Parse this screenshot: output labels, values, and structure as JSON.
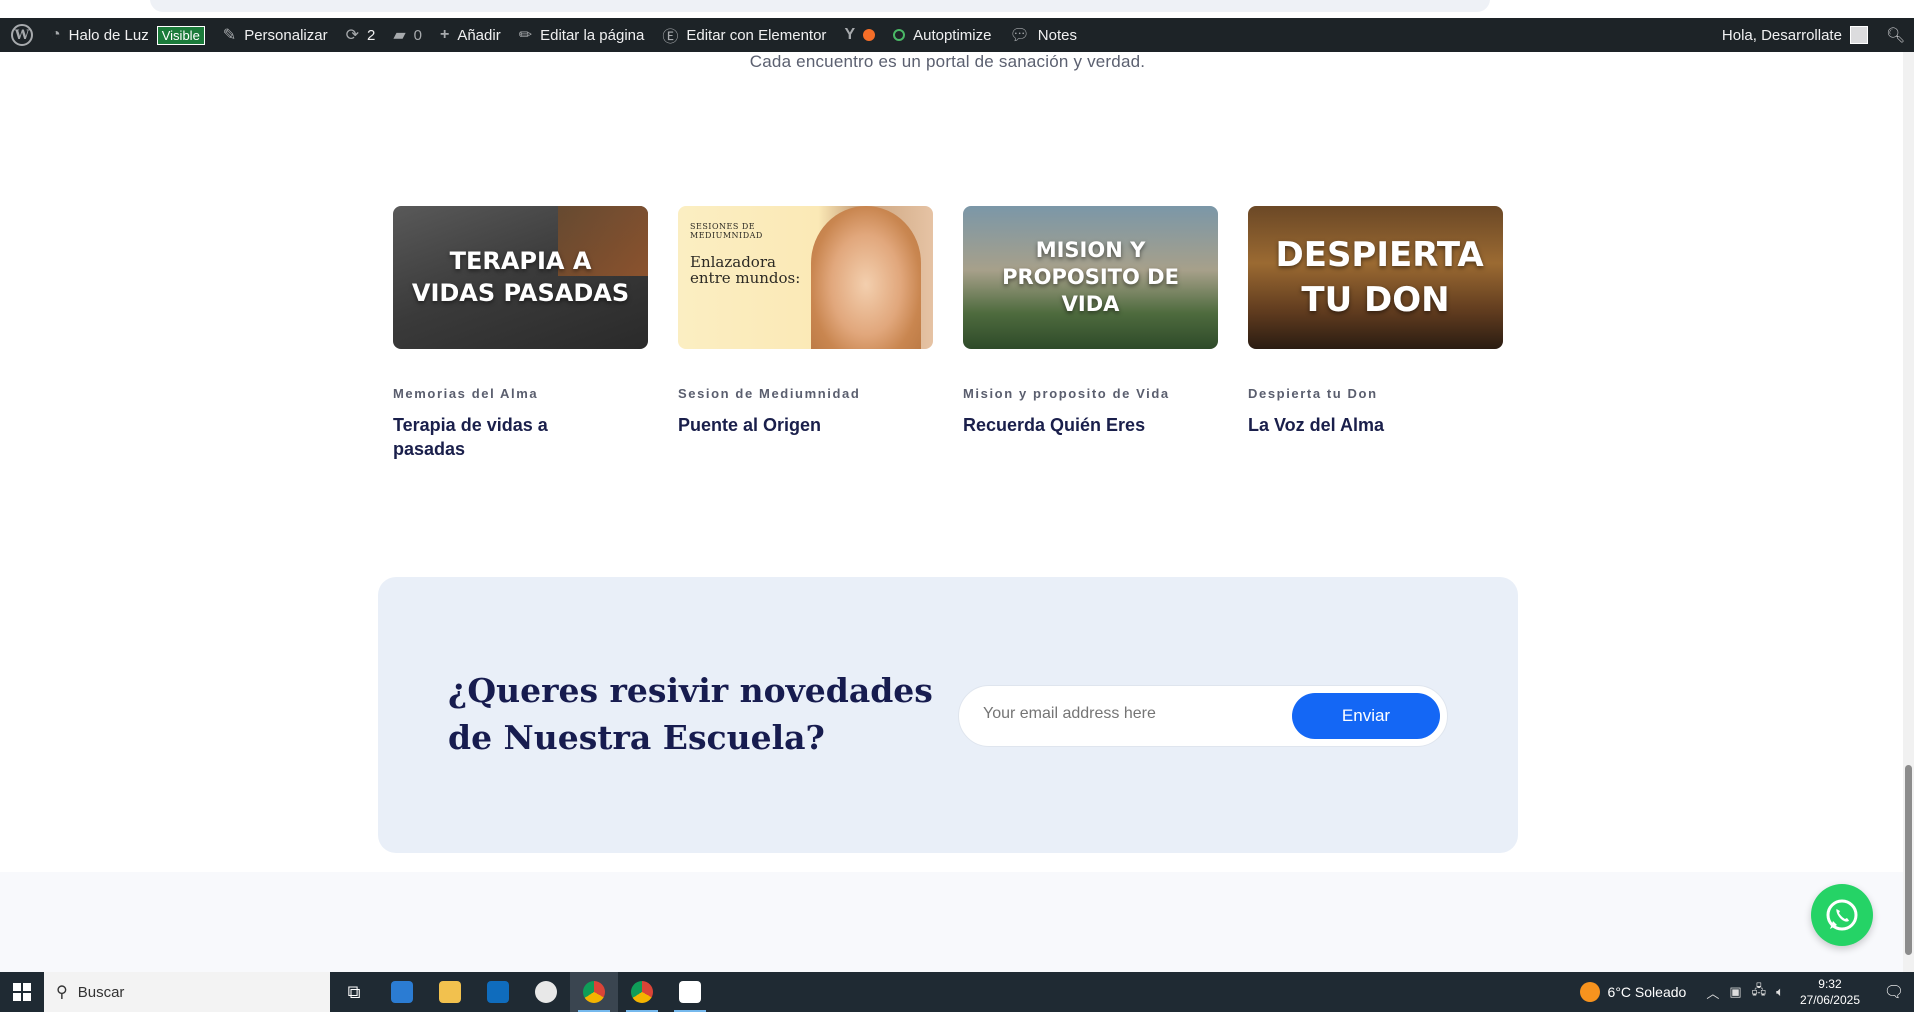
{
  "admin_bar": {
    "site_name": "Halo de Luz",
    "visibility_badge": "Visible",
    "customize": "Personalizar",
    "updates_count": "2",
    "comments_count": "0",
    "add_new": "Añadir",
    "edit_page": "Editar la página",
    "edit_elementor": "Editar con Elementor",
    "autoptimize": "Autoptimize",
    "notes": "Notes",
    "greeting": "Hola, Desarrollate"
  },
  "intro_text": "Cada encuentro es un portal de sanación y verdad.",
  "cards": [
    {
      "image_text": "TERAPIA A VIDAS PASADAS",
      "category": "Memorias del Alma",
      "title": "Terapia de vidas a pasadas"
    },
    {
      "image_text_small": "SESIONES DE MEDIUMNIDAD",
      "image_text": "Enlazadora entre mundos:",
      "category": "Sesion de Mediumnidad",
      "title": "Puente al Origen"
    },
    {
      "image_text": "MISION Y PROPOSITO DE VIDA",
      "category": "Mision y proposito de Vida",
      "title": "Recuerda Quién Eres"
    },
    {
      "image_text": "DESPIERTA TU DON",
      "category": "Despierta tu Don",
      "title": "La Voz del Alma"
    }
  ],
  "newsletter": {
    "heading": "¿Queres resivir novedades de Nuestra Escuela?",
    "email_placeholder": "Your email address here",
    "submit_label": "Enviar"
  },
  "taskbar": {
    "search_placeholder": "Buscar",
    "weather": "6°C  Soleado",
    "time": "9:32",
    "date": "27/06/2025"
  },
  "colors": {
    "admin_bar_bg": "#1d2327",
    "heading_navy": "#1a1f4b",
    "newsletter_bg": "#e9eff8",
    "button_blue": "#1467f5",
    "whatsapp_green": "#25d366"
  }
}
